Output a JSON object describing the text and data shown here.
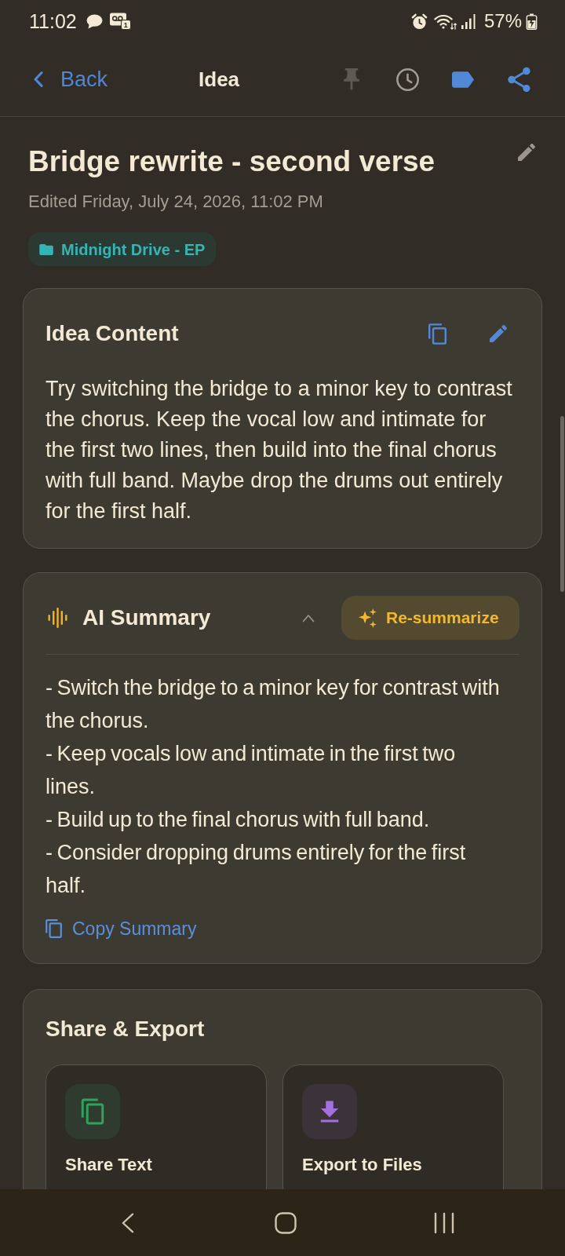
{
  "status_bar": {
    "time": "11:02",
    "notifications": [
      {
        "kind": "message"
      },
      {
        "kind": "voicemail",
        "badge": "1"
      }
    ],
    "battery": "57%",
    "charging": true
  },
  "header": {
    "back_label": "Back",
    "title": "Idea",
    "actions": [
      {
        "kind": "pin",
        "on": false
      },
      {
        "kind": "history"
      },
      {
        "kind": "label",
        "on": true
      },
      {
        "kind": "share"
      }
    ]
  },
  "note": {
    "title": "Bridge rewrite - second verse",
    "edited": "Edited Friday, July 24, 2026, 11:02 PM",
    "folder": "Midnight Drive - EP"
  },
  "idea_content": {
    "heading": "Idea Content",
    "body": "Try switching the bridge to a minor key to contrast the chorus. Keep the vocal low and intimate for the first two lines, then build into the final chorus with full band. Maybe drop the drums out entirely for the first half."
  },
  "ai_summary": {
    "heading": "AI Summary",
    "expanded": true,
    "action": "Re-summarize",
    "points": [
      "- Switch the bridge to a minor key for contrast with the chorus.",
      "- Keep vocals low and intimate in the first two lines.",
      "- Build up to the final chorus with full band.",
      "- Consider dropping drums entirely for the first half."
    ],
    "copy_label": "Copy Summary"
  },
  "share_export": {
    "heading": "Share & Export",
    "options": [
      {
        "kind": "share_text",
        "label": "Share Text"
      },
      {
        "kind": "export_files",
        "label": "Export to Files"
      }
    ]
  }
}
